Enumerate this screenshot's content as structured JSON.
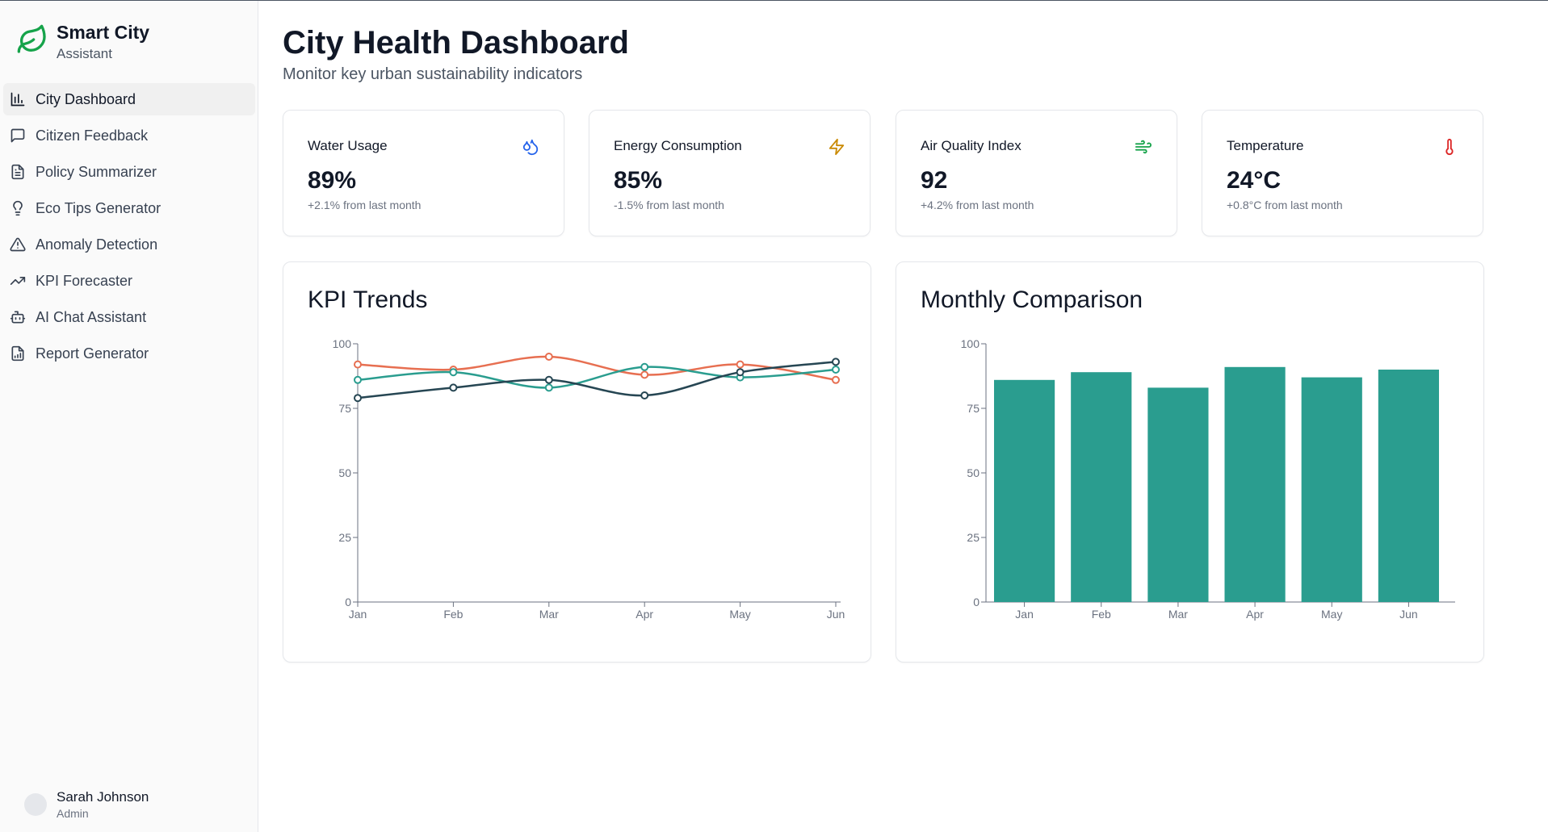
{
  "brand": {
    "title": "Smart City",
    "subtitle": "Assistant"
  },
  "nav": [
    {
      "label": "City Dashboard",
      "icon": "bar-chart-icon",
      "active": true
    },
    {
      "label": "Citizen Feedback",
      "icon": "message-square-icon"
    },
    {
      "label": "Policy Summarizer",
      "icon": "file-text-icon"
    },
    {
      "label": "Eco Tips Generator",
      "icon": "lightbulb-icon"
    },
    {
      "label": "Anomaly Detection",
      "icon": "alert-triangle-icon"
    },
    {
      "label": "KPI Forecaster",
      "icon": "trending-up-icon"
    },
    {
      "label": "AI Chat Assistant",
      "icon": "bot-icon"
    },
    {
      "label": "Report Generator",
      "icon": "file-chart-icon"
    }
  ],
  "user": {
    "name": "Sarah Johnson",
    "role": "Admin"
  },
  "header": {
    "title": "City Health Dashboard",
    "subtitle": "Monitor key urban sustainability indicators"
  },
  "kpis": [
    {
      "label": "Water Usage",
      "value": "89%",
      "change": "+2.1% from last month",
      "icon": "droplets-icon",
      "color": "#2563eb"
    },
    {
      "label": "Energy Consumption",
      "value": "85%",
      "change": "-1.5% from last month",
      "icon": "zap-icon",
      "color": "#ca8a04"
    },
    {
      "label": "Air Quality Index",
      "value": "92",
      "change": "+4.2% from last month",
      "icon": "wind-icon",
      "color": "#16a34a"
    },
    {
      "label": "Temperature",
      "value": "24°C",
      "change": "+0.8°C from last month",
      "icon": "thermometer-icon",
      "color": "#dc2626"
    }
  ],
  "panels": {
    "trends_title": "KPI Trends",
    "comparison_title": "Monthly Comparison"
  },
  "chart_data": [
    {
      "type": "line",
      "title": "KPI Trends",
      "categories": [
        "Jan",
        "Feb",
        "Mar",
        "Apr",
        "May",
        "Jun"
      ],
      "ylim": [
        0,
        100
      ],
      "yticks": [
        0,
        25,
        50,
        75,
        100
      ],
      "grid": false,
      "series": [
        {
          "values": [
            92,
            90,
            95,
            88,
            92,
            86
          ],
          "color": "#e76f51"
        },
        {
          "values": [
            86,
            89,
            83,
            91,
            87,
            90
          ],
          "color": "#2a9d8f"
        },
        {
          "values": [
            79,
            83,
            86,
            80,
            89,
            93
          ],
          "color": "#264653"
        }
      ]
    },
    {
      "type": "bar",
      "title": "Monthly Comparison",
      "categories": [
        "Jan",
        "Feb",
        "Mar",
        "Apr",
        "May",
        "Jun"
      ],
      "values": [
        86,
        89,
        83,
        91,
        87,
        90
      ],
      "ylim": [
        0,
        100
      ],
      "yticks": [
        0,
        25,
        50,
        75,
        100
      ],
      "grid": false,
      "color": "#2a9d8f"
    }
  ]
}
